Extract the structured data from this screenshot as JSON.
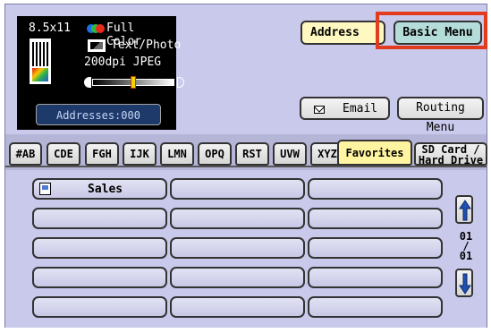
{
  "status": {
    "paper_size": "8.5x11",
    "color_mode": "Full Color",
    "image_mode": "Text/Photo",
    "resolution_format": "200dpi JPEG",
    "addresses_label": "Addresses:000"
  },
  "top_buttons": {
    "address_book": "Address Boo",
    "basic_menu": "Basic Menu"
  },
  "action_buttons": {
    "email": "Email",
    "routing_menu": "Routing Menu"
  },
  "tabs": [
    {
      "label": "#AB"
    },
    {
      "label": "CDE"
    },
    {
      "label": "FGH"
    },
    {
      "label": "IJK"
    },
    {
      "label": "LMN"
    },
    {
      "label": "OPQ"
    },
    {
      "label": "RST"
    },
    {
      "label": "UVW"
    },
    {
      "label": "XYZ"
    },
    {
      "label": "Favorites"
    },
    {
      "label": "SD Card /"
    },
    {
      "label": "Hard Drive"
    }
  ],
  "destinations": {
    "first": "Sales"
  },
  "paging": {
    "current": "01",
    "separator": "/",
    "total": "01"
  },
  "colors": {
    "highlight": "#e23b1e",
    "basic_menu_bg": "#b4dcd8",
    "address_book_bg": "#fff8c0",
    "active_tab_bg": "#fff4a0"
  }
}
